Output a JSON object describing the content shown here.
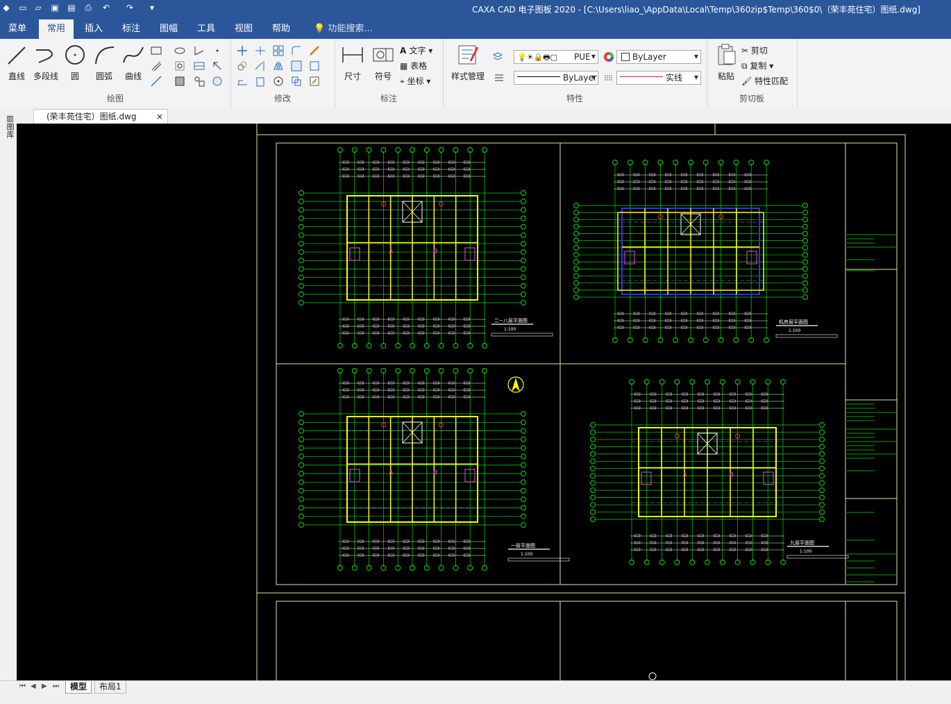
{
  "app": {
    "title": "CAXA CAD 电子图板 2020 - [C:\\Users\\liao_\\AppData\\Local\\Temp\\360zip$Temp\\360$0\\（荣丰苑住宅）图纸.dwg]"
  },
  "menu": {
    "tabs": [
      "菜单",
      "常用",
      "插入",
      "标注",
      "图幅",
      "工具",
      "视图",
      "帮助"
    ],
    "active": "常用",
    "search_placeholder": "功能搜索..."
  },
  "ribbon": {
    "draw": {
      "label": "绘图",
      "buttons": [
        "直线",
        "多段线",
        "圆",
        "圆弧",
        "曲线"
      ]
    },
    "modify": {
      "label": "修改"
    },
    "annotate": {
      "label": "标注",
      "buttons": [
        "尺寸",
        "符号"
      ],
      "small": [
        "文字",
        "表格",
        "坐标"
      ]
    },
    "properties": {
      "label": "特性",
      "style_button": "样式管理",
      "layer_value": "PUE",
      "color_value": "ByLayer",
      "linetype_value": "ByLayer",
      "lineweight_value": "实线"
    },
    "clipboard": {
      "label": "剪切板",
      "paste": "粘贴",
      "cut": "剪切",
      "copy": "复制",
      "match": "特性匹配"
    }
  },
  "document": {
    "tab_label": "(荣丰苑住宅）图纸.dwg",
    "close": "×",
    "side_label": "图库"
  },
  "drawing": {
    "plans": [
      {
        "title": "二~八层平面图",
        "scale": "1:100"
      },
      {
        "title": "机房层平面图",
        "scale": "1:100"
      },
      {
        "title": "一层平面图",
        "scale": "1:100"
      },
      {
        "title": "九层平面图",
        "scale": "1:100"
      }
    ],
    "unit_labels": [
      "A",
      "B"
    ],
    "colors": {
      "frame": "#e8e8a0",
      "axis": "#00e000",
      "wall": "#ffff00",
      "dim": "#ffffff",
      "center": "#7a4bd8",
      "blue": "#3030ff",
      "magenta": "#ff40ff",
      "red": "#ff3030"
    }
  },
  "layout_tabs": {
    "tabs": [
      "模型",
      "布局1"
    ],
    "active": "模型",
    "nav": [
      "⏮",
      "◀",
      "▶",
      "⏭"
    ]
  }
}
